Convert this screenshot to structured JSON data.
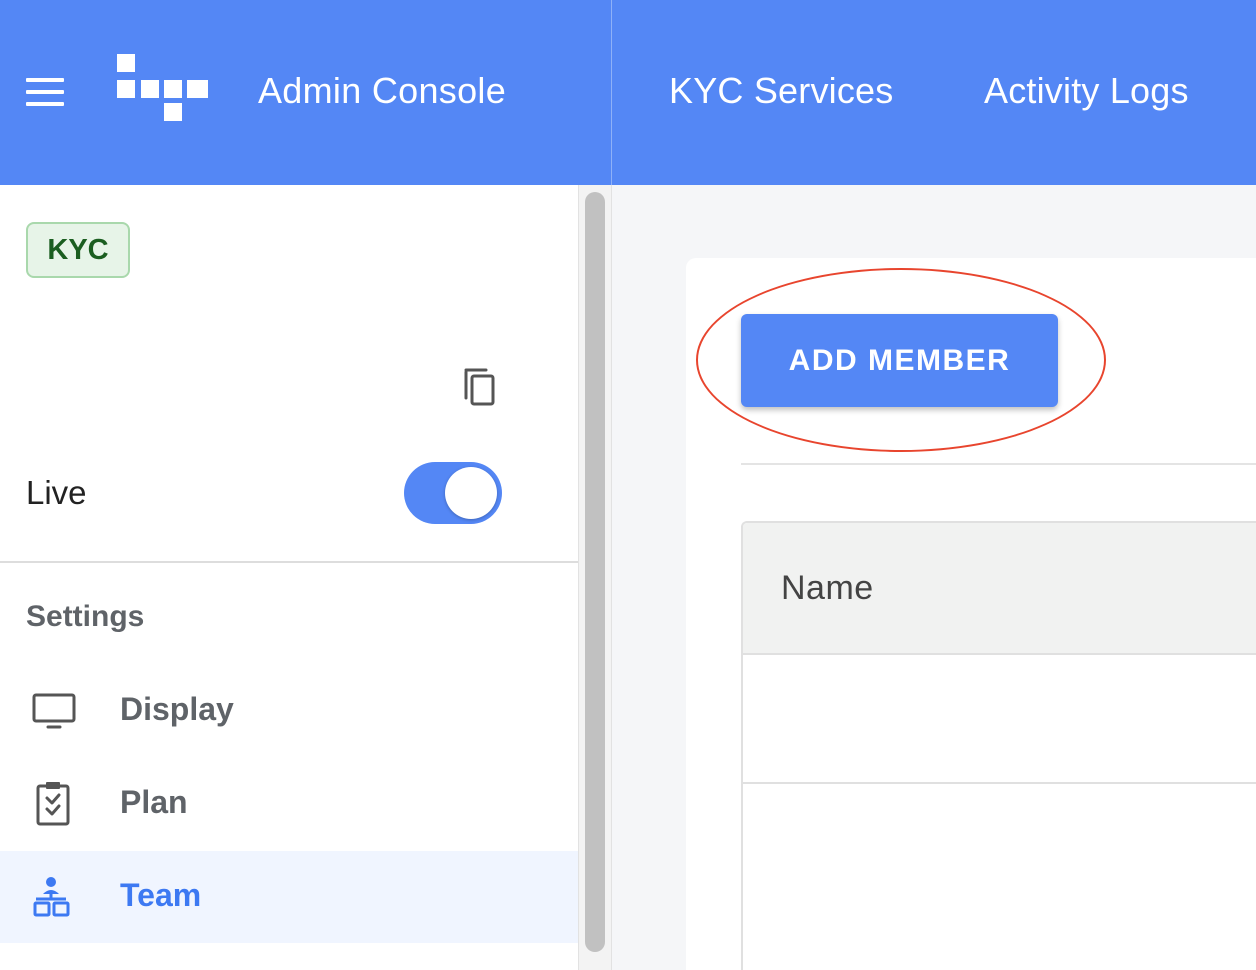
{
  "header": {
    "app_title": "Admin Console",
    "nav": [
      {
        "label": "KYC Services"
      },
      {
        "label": "Activity Logs"
      }
    ]
  },
  "sidebar": {
    "badge": "KYC",
    "live_label": "Live",
    "live_toggle_on": true,
    "section_title": "Settings",
    "items": [
      {
        "label": "Display",
        "icon": "monitor-icon",
        "active": false
      },
      {
        "label": "Plan",
        "icon": "clipboard-check-icon",
        "active": false
      },
      {
        "label": "Team",
        "icon": "org-chart-icon",
        "active": true
      }
    ]
  },
  "main": {
    "add_button_label": "ADD MEMBER",
    "table": {
      "columns": [
        "Name"
      ],
      "rows": []
    }
  },
  "colors": {
    "primary": "#5487F5",
    "active_text": "#3D79F2",
    "badge_bg": "#E7F4E8",
    "badge_text": "#1B5E20",
    "annotation": "#E8452E"
  }
}
